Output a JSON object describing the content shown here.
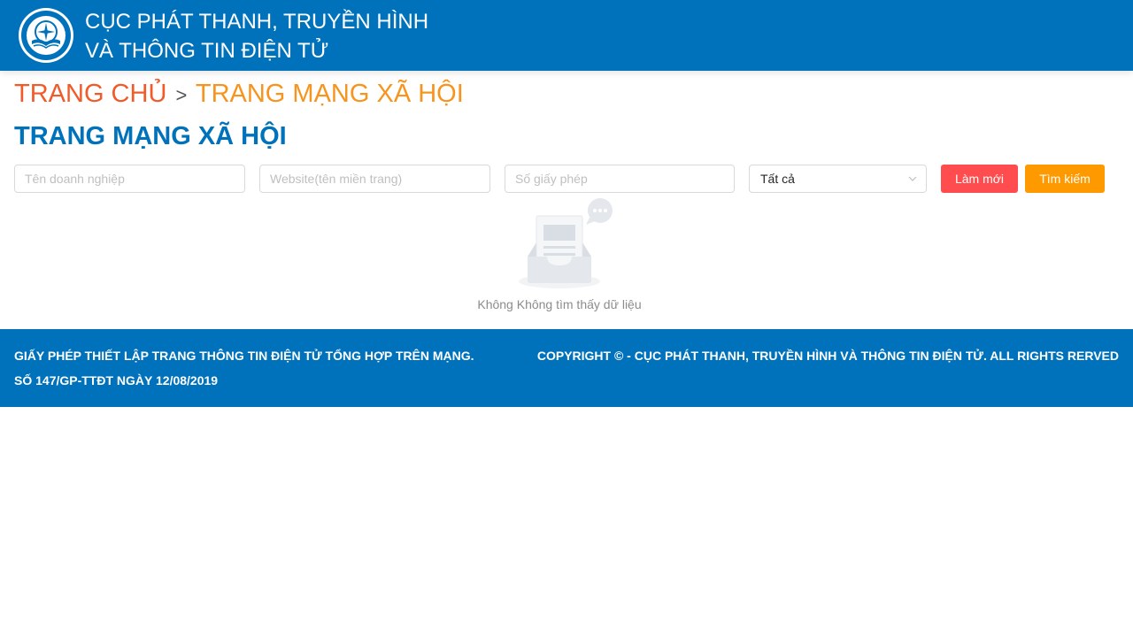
{
  "header": {
    "org_name_line1": "CỤC PHÁT THANH, TRUYỀN HÌNH",
    "org_name_line2": "VÀ THÔNG TIN ĐIỆN TỬ",
    "logo_icon": "emblem-logo",
    "background_color": "#0072bc"
  },
  "breadcrumb": {
    "home": "TRANG CHỦ",
    "separator": ">",
    "current": "TRANG MẠNG XÃ HỘI"
  },
  "page": {
    "title": "TRANG MẠNG XÃ HỘI"
  },
  "filters": {
    "company_name": {
      "value": "",
      "placeholder": "Tên doanh nghiệp"
    },
    "website": {
      "value": "",
      "placeholder": "Website(tên miền trang)"
    },
    "license_number": {
      "value": "",
      "placeholder": "Số giấy phép"
    },
    "status_select": {
      "selected": "Tất cả"
    }
  },
  "actions": {
    "reset_label": "Làm mới",
    "search_label": "Tìm kiếm",
    "reset_color": "#ff4d4f",
    "search_color": "#ff9900"
  },
  "results": {
    "empty_icon": "empty-inbox-icon",
    "empty_message": "Không Không tìm thấy dữ liệu"
  },
  "footer": {
    "license_line1": "GIẤY PHÉP THIẾT LẬP TRANG THÔNG TIN ĐIỆN TỬ TỔNG HỢP TRÊN MẠNG.",
    "license_line2": "SỐ 147/GP-TTĐT NGÀY 12/08/2019",
    "copyright": "COPYRIGHT © - CỤC PHÁT THANH, TRUYỀN HÌNH VÀ THÔNG TIN ĐIỆN TỬ. ALL RIGHTS RERVED"
  }
}
